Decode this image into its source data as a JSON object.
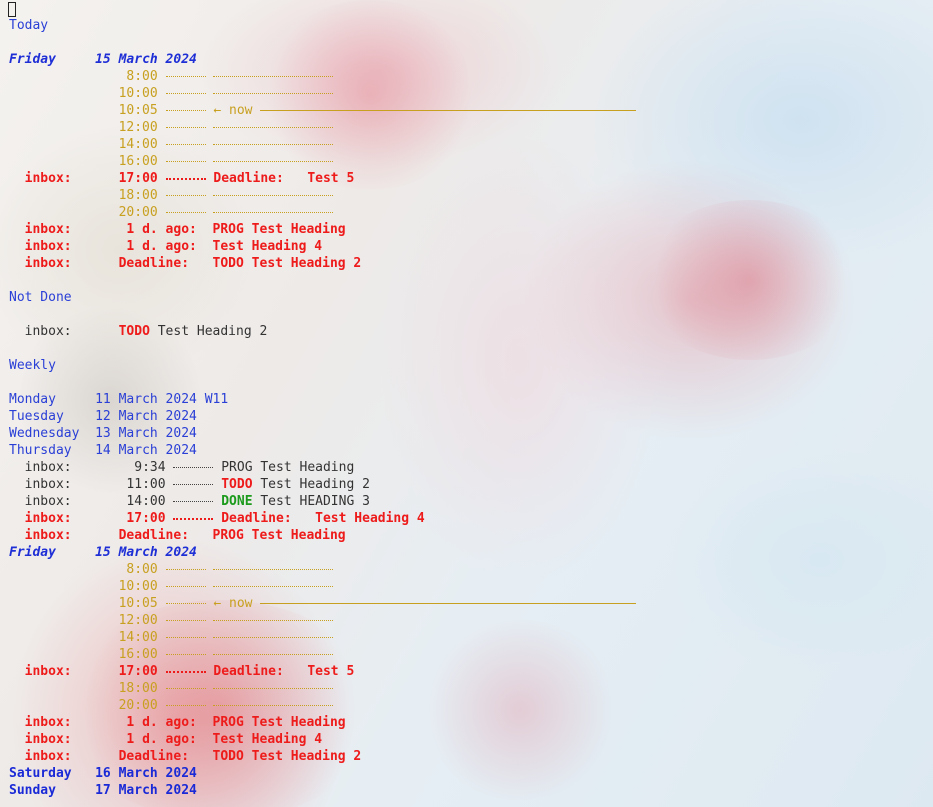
{
  "sections": {
    "today": "Today",
    "not_done": "Not Done",
    "weekly": "Weekly"
  },
  "today": {
    "day_name": "Friday",
    "date": "15 March 2024",
    "grid_times": [
      "8:00",
      "10:00",
      "10:05",
      "12:00",
      "14:00",
      "16:00",
      "17:00",
      "18:00",
      "20:00"
    ],
    "now_label": "← now",
    "deadline_entry": {
      "category": "inbox:",
      "time": "17:00",
      "label": "Deadline:",
      "title": "Test 5"
    },
    "overdue": [
      {
        "category": "inbox:",
        "when": "1 d. ago:",
        "keyword": "PROG",
        "title": "Test Heading"
      },
      {
        "category": "inbox:",
        "when": "1 d. ago:",
        "keyword": "",
        "title": "Test Heading 4"
      },
      {
        "category": "inbox:",
        "when": "Deadline:",
        "keyword": "TODO",
        "title": "Test Heading 2"
      }
    ]
  },
  "not_done": {
    "entry": {
      "category": "inbox:",
      "keyword": "TODO",
      "title": "Test Heading 2"
    }
  },
  "weekly": {
    "days": [
      {
        "name": "Monday",
        "date": "11 March 2024",
        "week": "W11"
      },
      {
        "name": "Tuesday",
        "date": "12 March 2024"
      },
      {
        "name": "Wednesday",
        "date": "13 March 2024"
      },
      {
        "name": "Thursday",
        "date": "14 March 2024"
      },
      {
        "name": "Friday",
        "date": "15 March 2024"
      },
      {
        "name": "Saturday",
        "date": "16 March 2024"
      },
      {
        "name": "Sunday",
        "date": "17 March 2024"
      }
    ],
    "thursday_entries": [
      {
        "category": "inbox:",
        "time": "9:34",
        "keyword": "PROG",
        "title": "Test Heading"
      },
      {
        "category": "inbox:",
        "time": "11:00",
        "keyword": "TODO",
        "title": "Test Heading 2"
      },
      {
        "category": "inbox:",
        "time": "14:00",
        "keyword": "DONE",
        "title": "Test HEADING 3"
      },
      {
        "category": "inbox:",
        "time": "17:00",
        "keyword": "Deadline:",
        "title": "Test Heading 4"
      },
      {
        "category": "inbox:",
        "time": "Deadline:",
        "keyword": "PROG",
        "title": "Test Heading"
      }
    ]
  },
  "colors": {
    "header_blue": "#2a3fd6",
    "grid_yellow": "#c8a020",
    "urgent_red": "#ee1b1b",
    "done_green": "#1c9a1c"
  }
}
